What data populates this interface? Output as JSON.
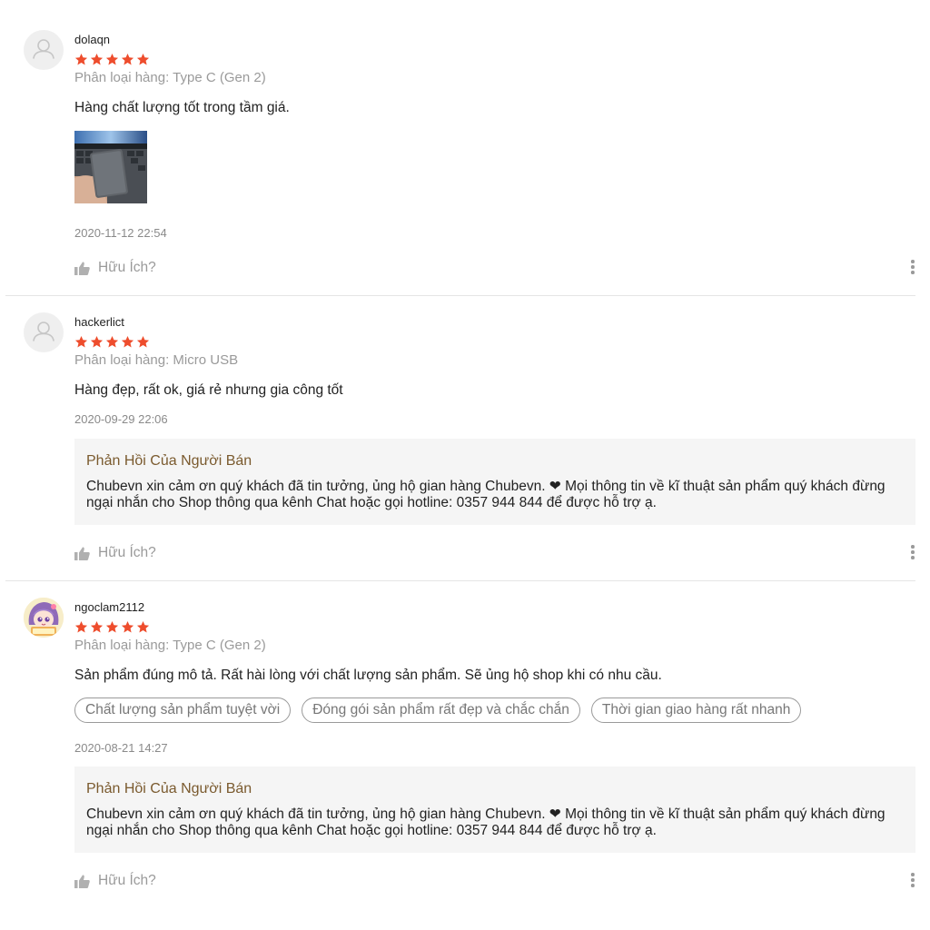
{
  "reviews": [
    {
      "username": "dolaqn",
      "rating": 5,
      "variation": "Phân loại hàng: Type C (Gen 2)",
      "comment": "Hàng chất lượng tốt trong tầm giá.",
      "timestamp": "2020-11-12 22:54",
      "helpful_label": "Hữu Ích?"
    },
    {
      "username": "hackerlict",
      "rating": 5,
      "variation": "Phân loại hàng: Micro USB",
      "comment": "Hàng đẹp, rất ok, giá rẻ nhưng gia công tốt",
      "timestamp": "2020-09-29 22:06",
      "reply_title": "Phản Hồi Của Người Bán",
      "reply_text": "Chubevn xin cảm ơn quý khách đã tin tưởng, ủng hộ gian hàng Chubevn. ❤ Mọi thông tin về kĩ thuật sản phẩm quý khách đừng ngại nhắn cho Shop thông qua kênh Chat hoặc gọi hotline: 0357 944 844 để được hỗ trợ ạ.",
      "helpful_label": "Hữu Ích?"
    },
    {
      "username": "ngoclam2112",
      "rating": 5,
      "variation": "Phân loại hàng: Type C (Gen 2)",
      "comment": "Sản phẩm đúng mô tả. Rất hài lòng với chất lượng sản phẩm. Sẽ ủng hộ shop khi có nhu cầu.",
      "tags": [
        "Chất lượng sản phẩm tuyệt vời",
        "Đóng gói sản phẩm rất đẹp và chắc chắn",
        "Thời gian giao hàng rất nhanh"
      ],
      "timestamp": "2020-08-21 14:27",
      "reply_title": "Phản Hồi Của Người Bán",
      "reply_text": "Chubevn xin cảm ơn quý khách đã tin tưởng, ủng hộ gian hàng Chubevn. ❤ Mọi thông tin về kĩ thuật sản phẩm quý khách đừng ngại nhắn cho Shop thông qua kênh Chat hoặc gọi hotline: 0357 944 844 để được hỗ trợ ạ.",
      "helpful_label": "Hữu Ích?"
    }
  ],
  "colors": {
    "star": "#ee4d2d",
    "reply_title": "#7a5a2e",
    "muted": "#9a9a9a"
  },
  "icons": {
    "avatar_default": "default-avatar-icon",
    "helpful": "thumbs-up-icon",
    "more": "more-vertical-icon",
    "star": "star-icon"
  }
}
